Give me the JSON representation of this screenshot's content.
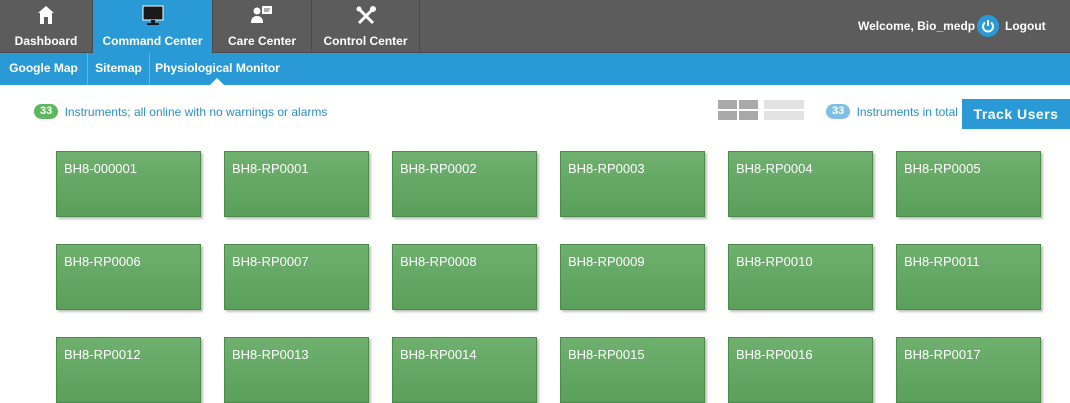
{
  "nav": {
    "tabs": [
      {
        "label": "Dashboard",
        "icon": "home-icon"
      },
      {
        "label": "Command Center",
        "icon": "monitor-icon"
      },
      {
        "label": "Care Center",
        "icon": "care-icon"
      },
      {
        "label": "Control Center",
        "icon": "tools-icon"
      }
    ],
    "active_tab": "Command Center",
    "welcome": "Welcome, Bio_medp",
    "logout_label": "Logout"
  },
  "subnav": {
    "items": [
      {
        "label": "Google Map"
      },
      {
        "label": "Sitemap"
      },
      {
        "label": "Physiological Monitor"
      }
    ],
    "active_item": "Physiological Monitor"
  },
  "status": {
    "count": "33",
    "message": "Instruments; all online with no warnings or alarms"
  },
  "totals": {
    "count": "33",
    "label": "Instruments in total"
  },
  "view_toggle": {
    "icons": [
      "grid-view-icon",
      "list-view-icon"
    ]
  },
  "track_button": "Track Users",
  "instruments": [
    "BH8-000001",
    "BH8-RP0001",
    "BH8-RP0002",
    "BH8-RP0003",
    "BH8-RP0004",
    "BH8-RP0005",
    "BH8-RP0006",
    "BH8-RP0007",
    "BH8-RP0008",
    "BH8-RP0009",
    "BH8-RP0010",
    "BH8-RP0011",
    "BH8-RP0012",
    "BH8-RP0013",
    "BH8-RP0014",
    "BH8-RP0015",
    "BH8-RP0016",
    "BH8-RP0017"
  ],
  "colors": {
    "nav_bg": "#5c5c5c",
    "accent_blue": "#2a9ad6",
    "tile_green": "#62a862",
    "status_pill": "#5cb85c"
  }
}
